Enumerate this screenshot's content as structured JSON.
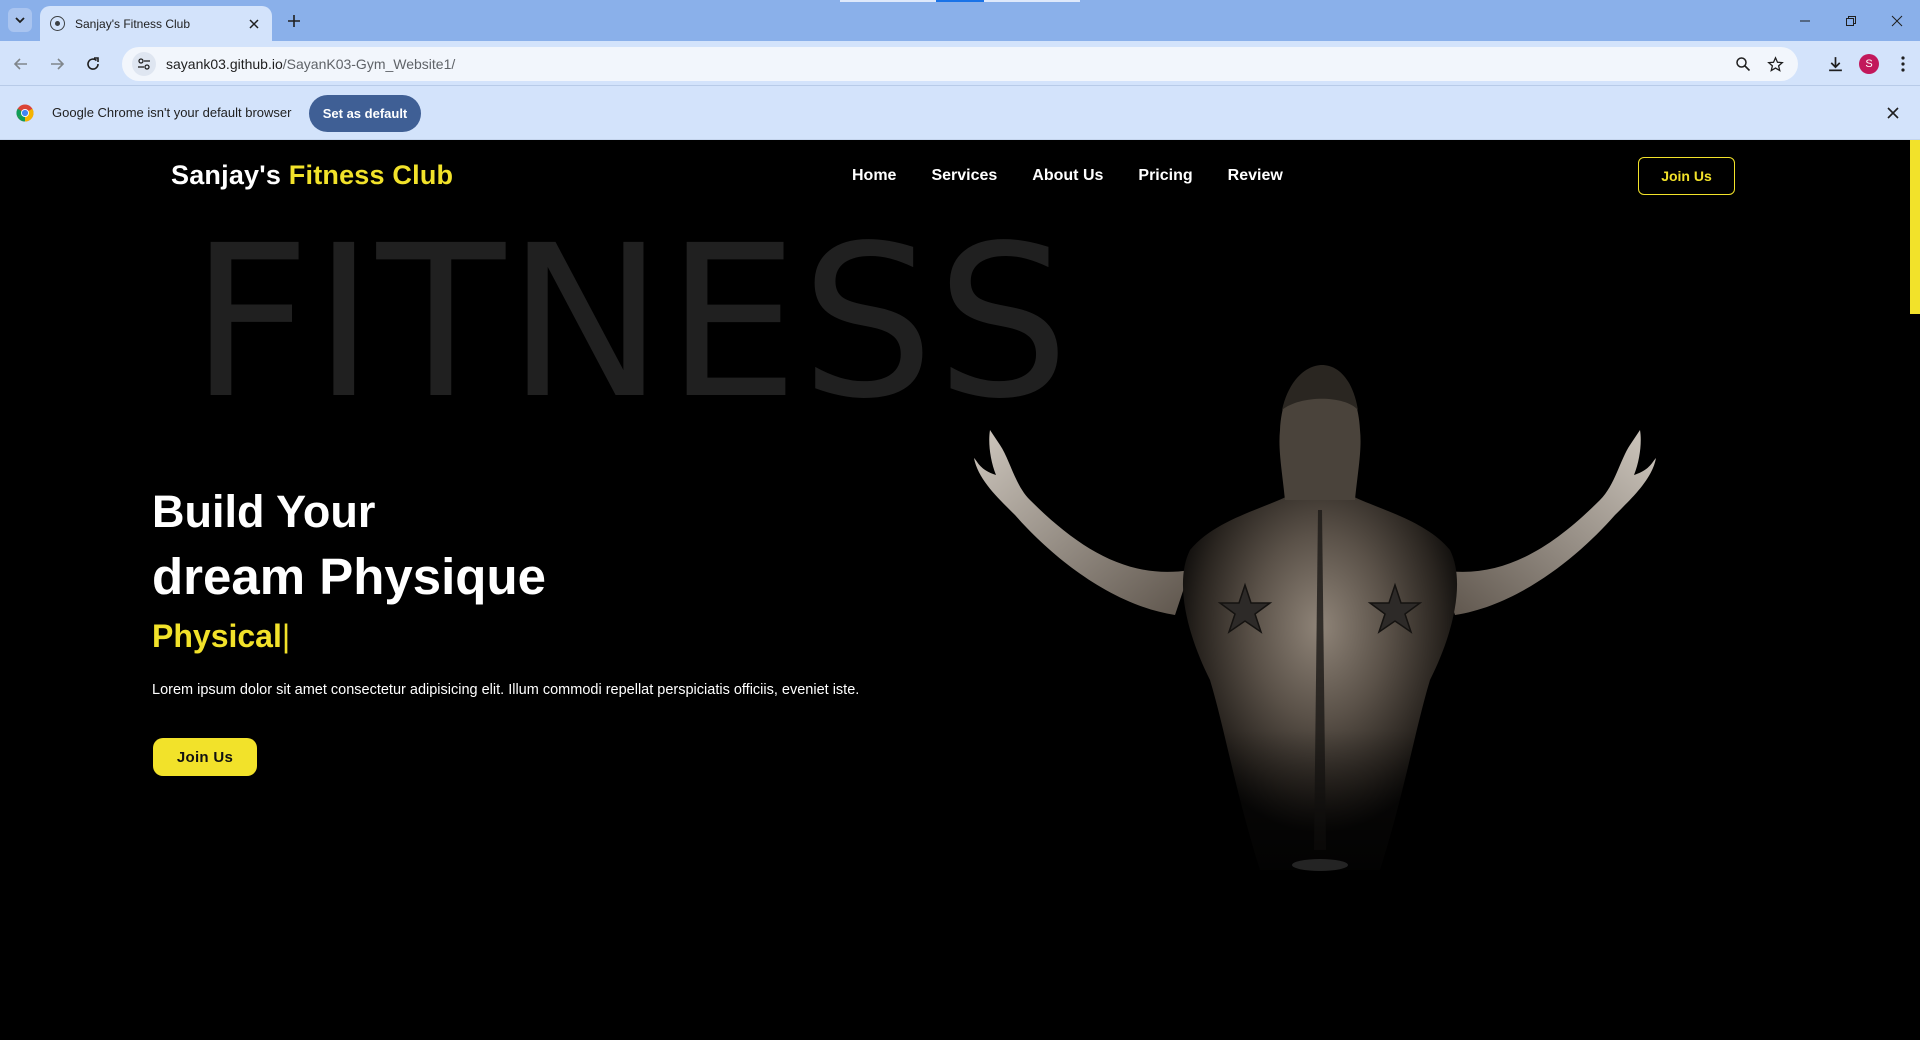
{
  "browser": {
    "tab_title": "Sanjay's Fitness Club",
    "url_host": "sayank03.github.io",
    "url_path": "/SayanK03-Gym_Website1/",
    "profile_initial": "S",
    "infobar_message": "Google Chrome isn't your default browser",
    "infobar_button": "Set as default"
  },
  "site": {
    "brand_name": "Sanjay's",
    "brand_accent": "Fitness Club",
    "nav": [
      "Home",
      "Services",
      "About Us",
      "Pricing",
      "Review"
    ],
    "header_cta": "Join Us",
    "background_word": "FITNESS",
    "headline_line1": "Build Your",
    "headline_line2": "dream Physique",
    "typed_word": "Physical",
    "typed_caret": "|",
    "description": "Lorem ipsum dolor sit amet consectetur adipisicing elit. Illum commodi repellat perspiciatis officiis, eveniet iste.",
    "hero_cta": "Join Us"
  },
  "colors": {
    "accent": "#f2e22a",
    "page_bg": "#000000",
    "chrome_frame": "#8ab0ea",
    "chrome_toolbar": "#d3e3fb",
    "infobar_button": "#3f5f95",
    "avatar": "#c2185b"
  },
  "icons": {
    "tab_list": "chevron-down-icon",
    "favicon": "globe-icon",
    "tab_close": "close-icon",
    "new_tab": "plus-icon",
    "back": "arrow-left-icon",
    "forward": "arrow-right-icon",
    "reload": "reload-icon",
    "site_info": "tune-icon",
    "zoom": "zoom-icon",
    "bookmark": "star-icon",
    "downloads": "download-icon",
    "menu": "kebab-menu-icon",
    "chrome": "chrome-logo-icon"
  }
}
